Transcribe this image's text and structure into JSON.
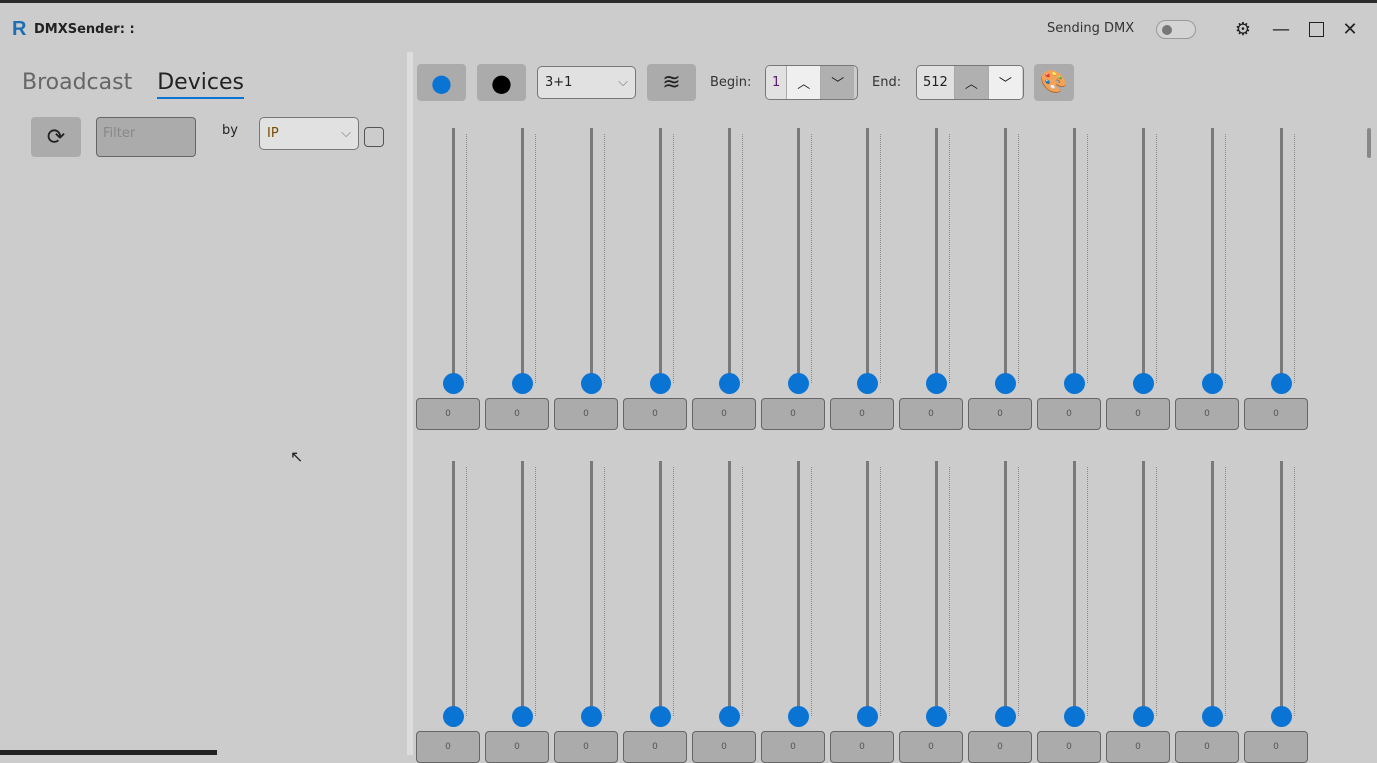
{
  "window": {
    "title": "DMXSender:  :",
    "sending_label": "Sending DMX",
    "sending_on": false
  },
  "tabs": [
    {
      "label": "Broadcast",
      "active": false
    },
    {
      "label": "Devices",
      "active": true
    }
  ],
  "devices": {
    "filter_placeholder": "Filter",
    "by_label": "by",
    "by_value": "IP",
    "checkbox_checked": false
  },
  "toolbar": {
    "mode_value": "3+1",
    "begin_label": "Begin:",
    "begin_value": "1",
    "end_label": "End:",
    "end_value": "512"
  },
  "channels": {
    "max": 255,
    "rows": [
      [
        0,
        0,
        0,
        0,
        0,
        0,
        0,
        0,
        0,
        0,
        0,
        0,
        0
      ],
      [
        0,
        0,
        0,
        0,
        0,
        0,
        0,
        0,
        0,
        0,
        0,
        0,
        0
      ]
    ]
  },
  "colors": {
    "accent": "#0a74d4"
  }
}
